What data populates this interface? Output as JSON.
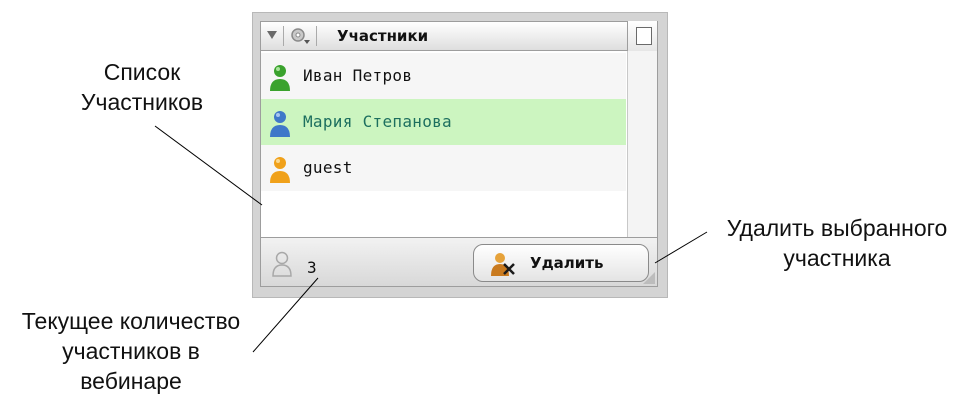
{
  "panel": {
    "title": "Участники",
    "participants": [
      {
        "name": "Иван Петров",
        "color": "#3aa22d",
        "selected": false
      },
      {
        "name": "Мария Степанова",
        "color": "#3f78c9",
        "selected": true
      },
      {
        "name": "guest",
        "color": "#f0a11a",
        "selected": false
      }
    ],
    "count": "3",
    "delete_label": "Удалить"
  },
  "annotations": {
    "list_line1": "Список",
    "list_line2": "Участников",
    "delete_line1": "Удалить выбранного",
    "delete_line2": "участника",
    "count_line1": "Текущее количество",
    "count_line2": "участников в",
    "count_line3": "вебинаре"
  },
  "colors": {
    "selected_row": "#ccf5c0",
    "selected_text": "#1d6f5f"
  }
}
